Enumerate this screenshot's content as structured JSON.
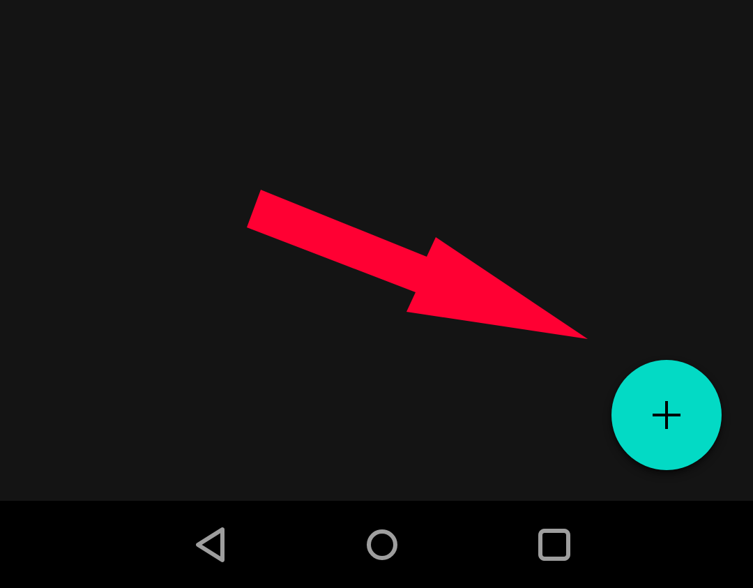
{
  "colors": {
    "background": "#141414",
    "nav_bar": "#000000",
    "fab": "#03DAC5",
    "fab_icon": "#000000",
    "annotation_arrow": "#FF0033",
    "nav_icons": "#9E9E9E"
  },
  "fab": {
    "icon": "plus-icon"
  },
  "annotation": {
    "icon": "arrow-pointer"
  },
  "nav_bar": {
    "back_icon": "back-triangle-icon",
    "home_icon": "home-circle-icon",
    "recents_icon": "recents-square-icon"
  }
}
